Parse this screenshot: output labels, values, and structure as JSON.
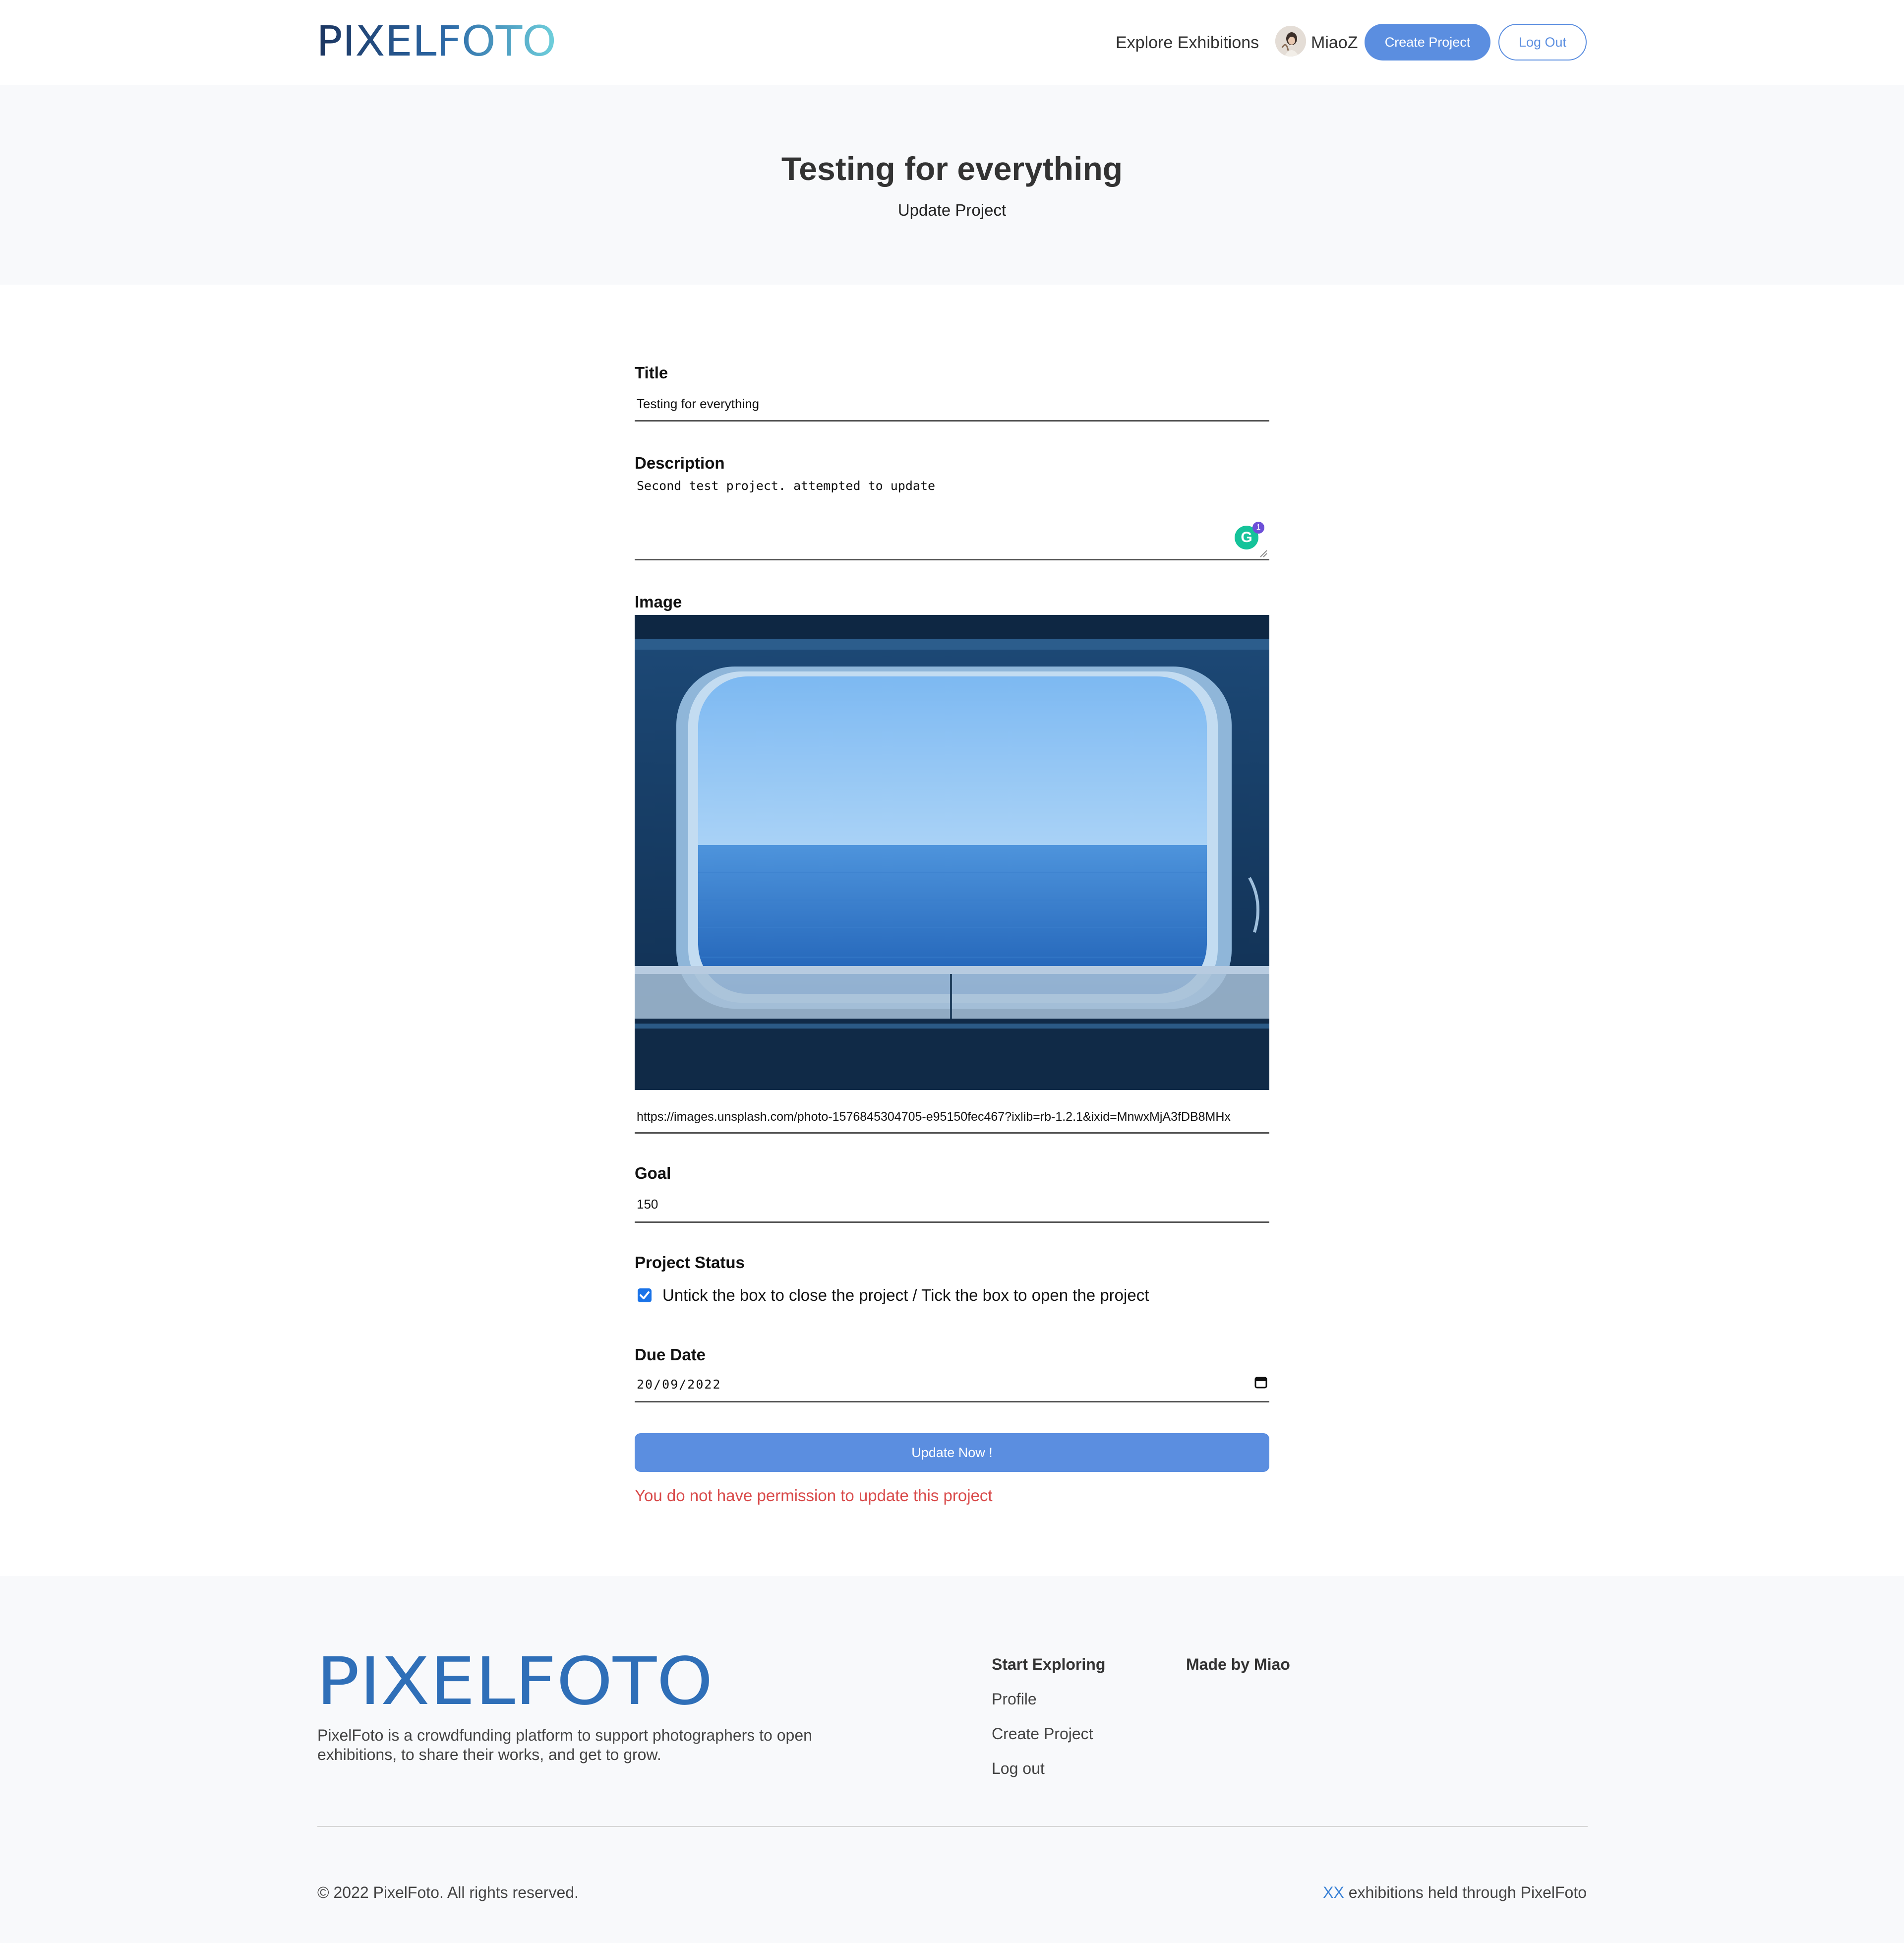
{
  "nav": {
    "logo_text": "PIXELFOTO",
    "explore_label": "Explore Exhibitions",
    "username": "MiaoZ",
    "create_label": "Create Project",
    "logout_label": "Log Out"
  },
  "hero": {
    "title": "Testing for everything",
    "subtitle": "Update Project"
  },
  "form": {
    "title_label": "Title",
    "title_value": "Testing for everything",
    "description_label": "Description",
    "description_value": "Second test project. attempted to update",
    "grammarly_icon": "G",
    "grammarly_count": "1",
    "image_label": "Image",
    "image_url": "https://images.unsplash.com/photo-1576845304705-e95150fec467?ixlib=rb-1.2.1&ixid=MnwxMjA3fDB8MHx",
    "goal_label": "Goal",
    "goal_value": "150",
    "status_label": "Project Status",
    "status_checked": true,
    "status_checkbox_label": "Untick the box to close the project / Tick the box to open the project",
    "due_label": "Due Date",
    "due_value": "20/09/2022",
    "submit_label": "Update Now !",
    "error_message": "You do not have permission to update this project"
  },
  "footer": {
    "logo_text": "PIXELFOTO",
    "description": "PixelFoto is a crowdfunding platform to support photographers to open exhibitions, to share their works, and get to grow.",
    "col1_title": "Start Exploring",
    "col1_links": [
      "Profile",
      "Create Project",
      "Log out"
    ],
    "col2_title": "Made by Miao",
    "copyright": "© 2022 PixelFoto. All rights reserved.",
    "stats_count": "XX",
    "stats_text": "exhibitions held through PixelFoto"
  },
  "colors": {
    "accent": "#5b8ee0",
    "error": "#d94b4b",
    "logo_dark": "#1f3d6b",
    "logo_light": "#67c4d8",
    "footer_bg": "#f8f9fb"
  }
}
